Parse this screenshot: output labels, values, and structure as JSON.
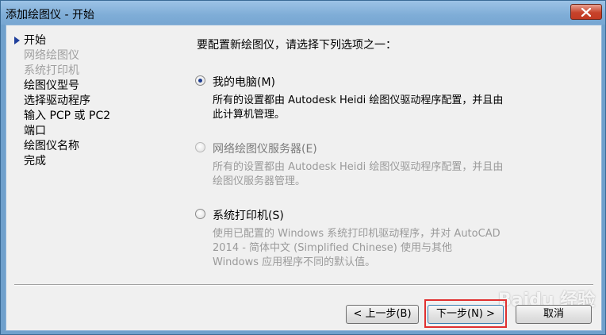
{
  "window": {
    "title": "添加绘图仪 - 开始"
  },
  "steps": [
    {
      "label": "开始",
      "state": "current"
    },
    {
      "label": "网络绘图仪",
      "state": "disabled"
    },
    {
      "label": "系统打印机",
      "state": "disabled"
    },
    {
      "label": "绘图仪型号",
      "state": "normal"
    },
    {
      "label": "选择驱动程序",
      "state": "normal"
    },
    {
      "label": "输入 PCP 或 PC2",
      "state": "normal"
    },
    {
      "label": "端口",
      "state": "normal"
    },
    {
      "label": "绘图仪名称",
      "state": "normal"
    },
    {
      "label": "完成",
      "state": "normal"
    }
  ],
  "main": {
    "prompt": "要配置新绘图仪，请选择下列选项之一：",
    "options": [
      {
        "label": "我的电脑(M)",
        "checked": true,
        "desc_lines": [
          "所有的设置都由 Autodesk Heidi 绘图仪驱动程序配置，并且由",
          "此计算机管理。"
        ]
      },
      {
        "label": "网络绘图仪服务器(E)",
        "checked": false,
        "desc_lines": [
          "所有的设置都由 Autodesk Heidi 绘图仪驱动程序配置，并且由",
          "绘图仪服务器管理。"
        ]
      },
      {
        "label": "系统打印机(S)",
        "checked": false,
        "desc_lines": [
          "使用已配置的 Windows 系统打印机驱动程序，并对 AutoCAD",
          "2014 - 简体中文 (Simplified Chinese) 使用与其他",
          "Windows 应用程序不同的默认值。"
        ]
      }
    ]
  },
  "buttons": {
    "back": "< 上一步(B)",
    "next": "下一步(N) >",
    "cancel": "取消"
  },
  "watermark": "Baidu 经验",
  "colors": {
    "title_bar": "#7fadd7",
    "close_button": "#c7432b",
    "highlight_box": "#e03030",
    "disabled_text": "#a0a0a0"
  }
}
